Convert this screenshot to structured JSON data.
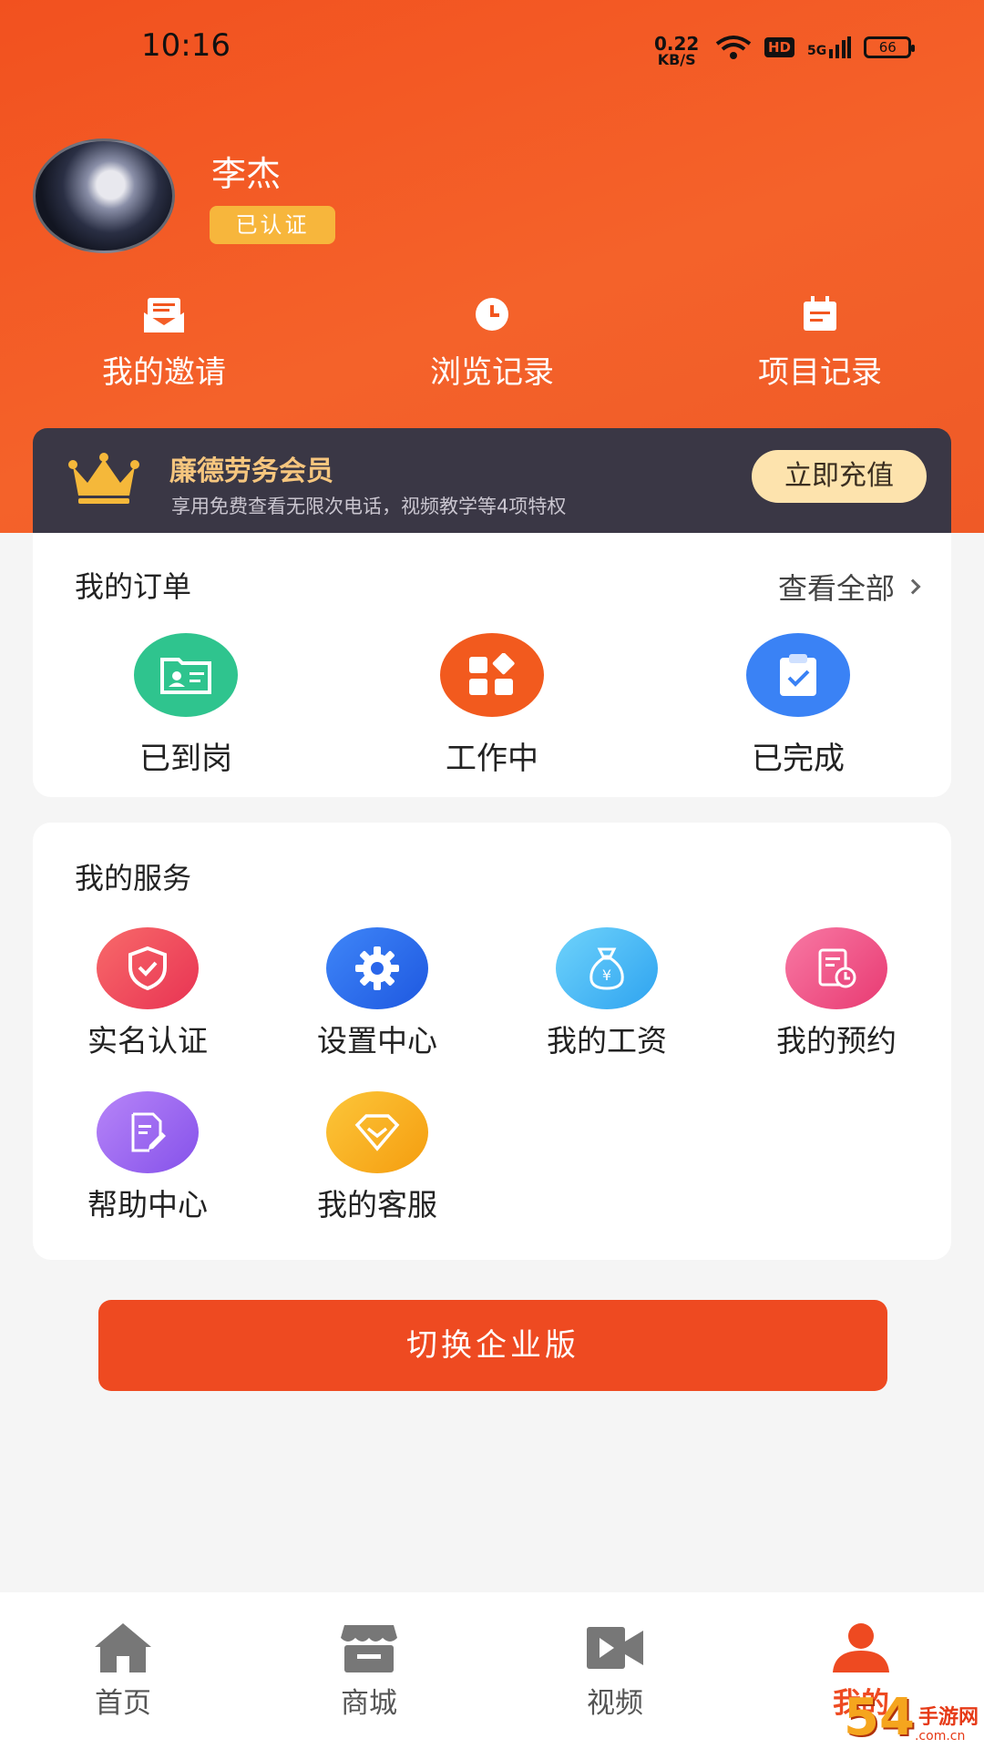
{
  "status_bar": {
    "time": "10:16",
    "net_speed_value": "0.22",
    "net_speed_unit": "KB/S",
    "hd": "HD",
    "network": "5G",
    "battery": "66"
  },
  "profile": {
    "name": "李杰",
    "badge": "已认证"
  },
  "quick_links": [
    {
      "label": "我的邀请",
      "icon": "invite-envelope-icon"
    },
    {
      "label": "浏览记录",
      "icon": "clock-icon"
    },
    {
      "label": "项目记录",
      "icon": "calendar-icon"
    }
  ],
  "vip": {
    "title": "廉德劳务会员",
    "desc": "享用免费查看无限次电话，视频教学等4项特权",
    "button": "立即充值"
  },
  "orders": {
    "title": "我的订单",
    "view_all": "查看全部",
    "items": [
      {
        "label": "已到岗",
        "icon": "id-card-icon",
        "color": "#2fc48e"
      },
      {
        "label": "工作中",
        "icon": "apps-grid-icon",
        "color": "#f25a1e"
      },
      {
        "label": "已完成",
        "icon": "clipboard-check-icon",
        "color": "#3a82f5"
      }
    ]
  },
  "services": {
    "title": "我的服务",
    "items": [
      {
        "label": "实名认证",
        "icon": "shield-check-icon",
        "color": "#ef4a5f"
      },
      {
        "label": "设置中心",
        "icon": "gear-icon",
        "color": "#2f6ff0"
      },
      {
        "label": "我的工资",
        "icon": "money-bag-icon",
        "color": "#42b7f5"
      },
      {
        "label": "我的预约",
        "icon": "schedule-doc-icon",
        "color": "#ef4d86"
      },
      {
        "label": "帮助中心",
        "icon": "edit-doc-icon",
        "color": "#9a63ee"
      },
      {
        "label": "我的客服",
        "icon": "diamond-icon",
        "color": "#f8ae1a"
      }
    ]
  },
  "switch_button": "切换企业版",
  "tabbar": {
    "items": [
      {
        "label": "首页",
        "icon": "home-icon"
      },
      {
        "label": "商城",
        "icon": "store-icon"
      },
      {
        "label": "视频",
        "icon": "video-camera-icon"
      },
      {
        "label": "我的",
        "icon": "user-icon"
      }
    ],
    "active_index": 3
  },
  "watermark": {
    "number": "54",
    "text": "手游网",
    "domain": ".com.cn"
  }
}
